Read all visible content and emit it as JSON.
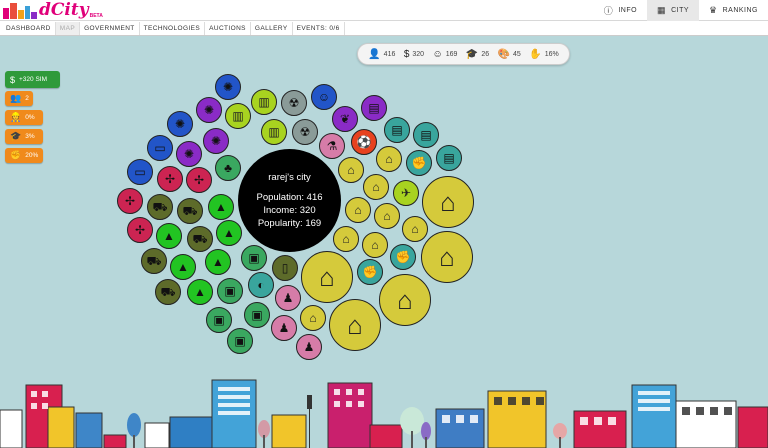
{
  "app": {
    "logo_text": "dCity",
    "beta": "BETA"
  },
  "topnav": [
    {
      "label": "INFO",
      "icon": "info-icon",
      "glyph": "ⓘ",
      "active": false
    },
    {
      "label": "CITY",
      "icon": "city-icon",
      "glyph": "▦",
      "active": true
    },
    {
      "label": "RANKING",
      "icon": "trophy-icon",
      "glyph": "♛",
      "active": false
    }
  ],
  "subnav": [
    {
      "label": "DASHBOARD",
      "disabled": false
    },
    {
      "label": "MAP",
      "disabled": true
    },
    {
      "label": "GOVERNMENT",
      "disabled": false
    },
    {
      "label": "TECHNOLOGIES",
      "disabled": false
    },
    {
      "label": "AUCTIONS",
      "disabled": false
    },
    {
      "label": "GALLERY",
      "disabled": false
    },
    {
      "label": "EVENTS: 0/6",
      "disabled": false
    }
  ],
  "stats": [
    {
      "icon": "person-icon",
      "glyph": "👤",
      "value": "416"
    },
    {
      "icon": "dollar-icon",
      "glyph": "$",
      "value": "320"
    },
    {
      "icon": "smile-icon",
      "glyph": "☺",
      "value": "169"
    },
    {
      "icon": "graduation-icon",
      "glyph": "🎓",
      "value": "26"
    },
    {
      "icon": "palette-icon",
      "glyph": "🎨",
      "value": "45"
    },
    {
      "icon": "hand-money-icon",
      "glyph": "✋",
      "value": "16%"
    }
  ],
  "badges": {
    "sim": {
      "label": "+320 SIM",
      "icon": "dollar-icon",
      "glyph": "$"
    },
    "workers": {
      "label": "2",
      "icon": "workers-icon",
      "glyph": "👥"
    },
    "unemployment": {
      "label": "0%",
      "icon": "worker-icon",
      "glyph": "👷"
    },
    "education": {
      "label": "3%",
      "icon": "student-icon",
      "glyph": "🎓"
    },
    "tax": {
      "label": "20%",
      "icon": "fist-icon",
      "glyph": "✊"
    }
  },
  "city": {
    "name": "rarej's city",
    "population_line": "Population: 416",
    "income_line": "Income: 320",
    "popularity_line": "Popularity: 169"
  },
  "colors": {
    "background": "#b7d7da",
    "house": "#d5ca3b",
    "building_green": "#3aa860",
    "camp_green": "#22c422",
    "crimson": "#cc2452",
    "virus_blue": "#2255c8",
    "purple": "#8a2bc6",
    "lime": "#a8d320",
    "teal": "#39a59d",
    "pink": "#d67ca8",
    "orange_red": "#e7421f",
    "olive": "#5d6b2a",
    "gray": "#8a9b98"
  }
}
